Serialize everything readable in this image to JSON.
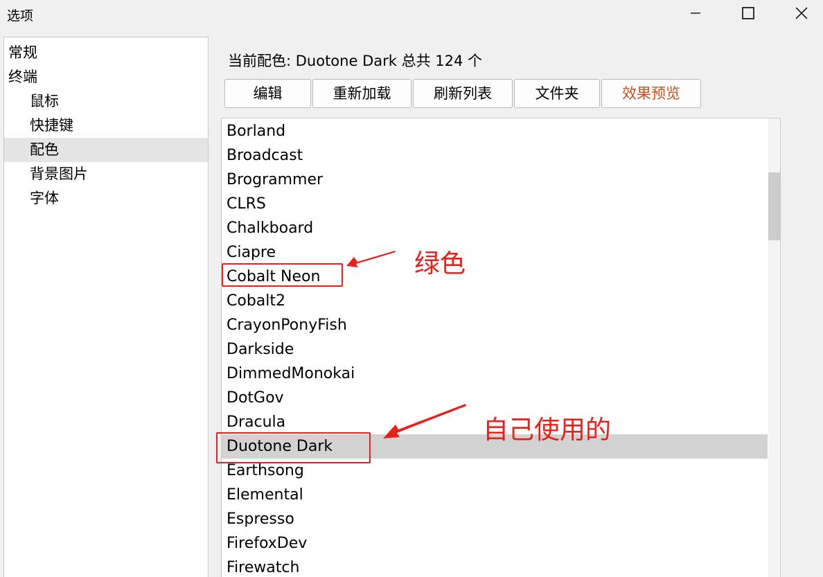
{
  "window": {
    "title": "选项",
    "controls": [
      "minimize-icon",
      "maximize-icon",
      "close-icon"
    ]
  },
  "nav": {
    "items": [
      {
        "label": "常规"
      },
      {
        "label": "终端"
      },
      {
        "label": "鼠标"
      },
      {
        "label": "快捷键"
      },
      {
        "label": "配色",
        "selected": true
      },
      {
        "label": "背景图片"
      },
      {
        "label": "字体"
      }
    ]
  },
  "current_scheme_text": "当前配色: Duotone Dark 总共 124 个",
  "toolbar": {
    "edit": "编辑",
    "reload": "重新加载",
    "refresh": "刷新列表",
    "folder": "文件夹",
    "preview": "效果预览"
  },
  "schemes": [
    "Borland",
    "Broadcast",
    "Brogrammer",
    "CLRS",
    "Chalkboard",
    "Ciapre",
    "Cobalt Neon",
    "Cobalt2",
    "CrayonPonyFish",
    "Darkside",
    "DimmedMonokai",
    "DotGov",
    "Dracula",
    "Duotone Dark",
    "Earthsong",
    "Elemental",
    "Espresso",
    "FirefoxDev",
    "Firewatch"
  ],
  "selected_scheme": "Duotone Dark",
  "annotations": {
    "green": "绿色",
    "my_use": "自己使用的"
  },
  "colors": {
    "annotation": "#e8201a",
    "preview_button_text": "#c5501d",
    "selection": "#d2d2d2"
  }
}
